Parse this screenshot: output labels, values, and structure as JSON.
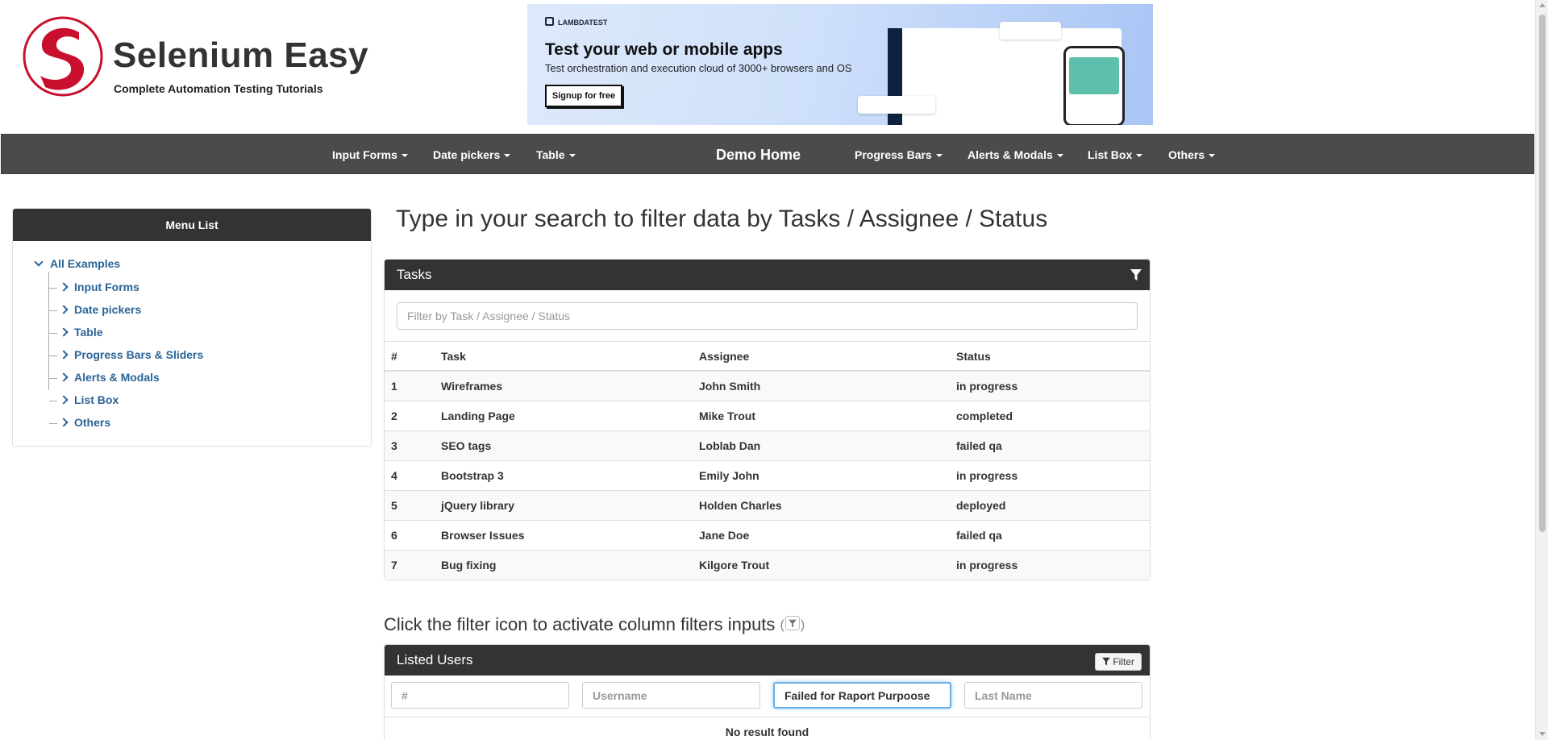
{
  "brand": {
    "title": "Selenium Easy",
    "subtitle": "Complete Automation Testing Tutorials",
    "logo_color": "#c8102e"
  },
  "ad": {
    "brand": "LAMBDATEST",
    "headline": "Test your web or mobile apps",
    "text": "Test orchestration and execution cloud of 3000+ browsers and OS",
    "cta": "Signup for free"
  },
  "nav": {
    "input_forms": "Input Forms",
    "date_pickers": "Date pickers",
    "table": "Table",
    "demo_home": "Demo Home",
    "progress_bars": "Progress Bars",
    "alerts_modals": "Alerts & Modals",
    "list_box": "List Box",
    "others": "Others"
  },
  "sidebar": {
    "title": "Menu List",
    "root": "All Examples",
    "items": [
      {
        "label": "Input Forms"
      },
      {
        "label": "Date pickers"
      },
      {
        "label": "Table"
      },
      {
        "label": "Progress Bars & Sliders"
      },
      {
        "label": "Alerts & Modals"
      },
      {
        "label": "List Box"
      },
      {
        "label": "Others"
      }
    ]
  },
  "main": {
    "title": "Type in your search to filter data by Tasks / Assignee / Status"
  },
  "tasks_panel": {
    "heading": "Tasks",
    "search_placeholder": "Filter by Task / Assignee / Status",
    "columns": [
      "#",
      "Task",
      "Assignee",
      "Status"
    ],
    "rows": [
      {
        "id": "1",
        "task": "Wireframes",
        "assignee": "John Smith",
        "status": "in progress"
      },
      {
        "id": "2",
        "task": "Landing Page",
        "assignee": "Mike Trout",
        "status": "completed"
      },
      {
        "id": "3",
        "task": "SEO tags",
        "assignee": "Loblab Dan",
        "status": "failed qa"
      },
      {
        "id": "4",
        "task": "Bootstrap 3",
        "assignee": "Emily John",
        "status": "in progress"
      },
      {
        "id": "5",
        "task": "jQuery library",
        "assignee": "Holden Charles",
        "status": "deployed"
      },
      {
        "id": "6",
        "task": "Browser Issues",
        "assignee": "Jane Doe",
        "status": "failed qa"
      },
      {
        "id": "7",
        "task": "Bug fixing",
        "assignee": "Kilgore Trout",
        "status": "in progress"
      }
    ]
  },
  "users_section": {
    "title": "Click the filter icon to activate column filters inputs",
    "heading": "Listed Users",
    "filter_button": "Filter",
    "filters": {
      "id_placeholder": "#",
      "username_placeholder": "Username",
      "first_name_value": "Failed for Raport Purpoose",
      "last_name_placeholder": "Last Name"
    },
    "empty_message": "No result found"
  }
}
